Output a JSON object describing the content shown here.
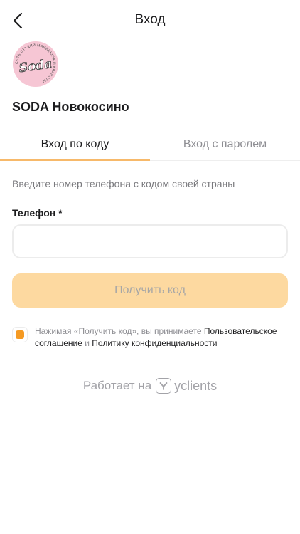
{
  "header": {
    "title": "Вход",
    "back_icon": "chevron-left-icon"
  },
  "company": {
    "logo_text": "Soda",
    "logo_ring_text": "СЕТЬ СТУДИЙ МАНИКЮРА И КРАСОТЫ",
    "name": "SODA Новокосино",
    "logo_bg": "#f6c6d4"
  },
  "tabs": [
    {
      "label": "Вход по коду",
      "active": true
    },
    {
      "label": "Вход с паролем",
      "active": false
    }
  ],
  "form": {
    "hint": "Введите номер телефона с кодом своей страны",
    "phone_label": "Телефон *",
    "phone_value": "",
    "phone_placeholder": "",
    "submit_label": "Получить код"
  },
  "consent": {
    "checked": true,
    "text_before": "Нажимая «Получить код», вы принимаете ",
    "terms_link": "Пользовательское соглашение",
    "and": " и ",
    "privacy_link": "Политику конфиденциальности"
  },
  "footer": {
    "powered_by": "Работает на",
    "brand": "yclients"
  },
  "colors": {
    "accent": "#f59a23",
    "button_disabled": "#fdd9a0",
    "tab_underline": "#f7b96a"
  }
}
